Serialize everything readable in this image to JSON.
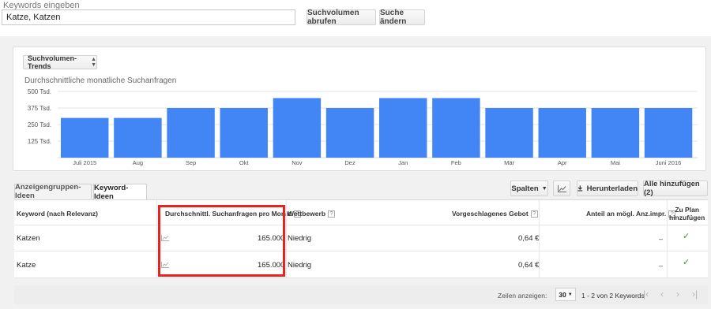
{
  "search": {
    "label": "Keywords eingeben",
    "value": "Katze, Katzen",
    "volume_button": "Suchvolumen abrufen",
    "change_button": "Suche ändern"
  },
  "chart_card": {
    "trend_select": "Suchvolumen-Trends",
    "title": "Durchschnittliche monatliche Suchanfragen"
  },
  "chart_data": {
    "type": "bar",
    "categories": [
      "Juli 2015",
      "Aug",
      "Sep",
      "Okt",
      "Nov",
      "Dez",
      "Jan",
      "Feb",
      "Mär",
      "Apr",
      "Mai",
      "Juni 2016"
    ],
    "values": [
      300000,
      300000,
      375000,
      375000,
      450000,
      375000,
      450000,
      450000,
      375000,
      375000,
      375000,
      375000
    ],
    "ylim": [
      0,
      500000
    ],
    "yticks": [
      125000,
      250000,
      375000,
      500000
    ],
    "ytick_labels": [
      "125 Tsd.",
      "250 Tsd.",
      "375 Tsd.",
      "500 Tsd."
    ],
    "color": "#4285f4",
    "grid": true
  },
  "tabs": {
    "ad_groups": "Anzeigengruppen-Ideen",
    "keyword_ideas": "Keyword-Ideen"
  },
  "toolbar": {
    "columns": "Spalten",
    "download": "Herunterladen",
    "add_all": "Alle hinzufügen (2)"
  },
  "table": {
    "headers": {
      "keyword": "Keyword (nach Relevanz)",
      "avg_searches": "Durchschnittl. Suchanfragen pro Monat",
      "competition": "Wettbewerb",
      "suggested_bid": "Vorgeschlagenes Gebot",
      "impr_share": "Anteil an mögl. Anz.impr.",
      "add_to_plan_1": "Zu Plan",
      "add_to_plan_2": "hinzufügen"
    },
    "help_glyph": "?",
    "rows": [
      {
        "keyword": "Katzen",
        "avg_searches": "165.000",
        "competition": "Niedrig",
        "bid": "0,64 €",
        "impr_share": "–"
      },
      {
        "keyword": "Katze",
        "avg_searches": "165.000",
        "competition": "Niedrig",
        "bid": "0,64 €",
        "impr_share": "–"
      }
    ]
  },
  "footer": {
    "rows_label": "Zeilen anzeigen:",
    "rows_value": "30",
    "range": "1 - 2 von 2 Keywords"
  },
  "colors": {
    "bar": "#4285f4",
    "highlight_box": "#e8231f",
    "check": "#2a9a2a"
  }
}
